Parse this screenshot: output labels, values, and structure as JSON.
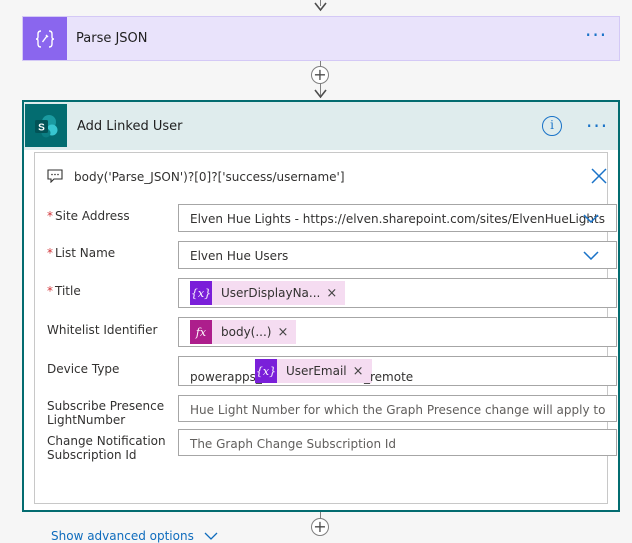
{
  "parse_json": {
    "title": "Parse JSON",
    "more_label": "···",
    "icon": "braces-icon",
    "accent": "#8a66ee"
  },
  "action": {
    "title": "Add Linked User",
    "info_label": "i",
    "more_label": "···",
    "icon": "sharepoint-icon",
    "accent": "#036c70",
    "foreach_expression": "body('Parse_JSON')?[0]?['success/username']",
    "fields": {
      "site_address": {
        "label": "Site Address",
        "required_mark": "*",
        "value": "Elven Hue Lights - https://elven.sharepoint.com/sites/ElvenHueLights"
      },
      "list_name": {
        "label": "List Name",
        "required_mark": "*",
        "value": "Elven Hue Users"
      },
      "title": {
        "label": "Title",
        "required_mark": "*",
        "token": {
          "label": "UserDisplayNa...",
          "icon_text": "{x}"
        },
        "remove": "×"
      },
      "whitelist_identifier": {
        "label": "Whitelist Identifier",
        "token": {
          "label": "body(...)",
          "icon_text": "fx"
        },
        "remove": "×"
      },
      "device_type": {
        "label": "Device Type",
        "prefix": "powerapps_",
        "token": {
          "label": "UserEmail",
          "icon_text": "{x}"
        },
        "remove": "×",
        "suffix": "_remote"
      },
      "subscribe_presence": {
        "label_line1": "Subscribe Presence",
        "label_line2": "LightNumber",
        "placeholder": "Hue Light Number for which the Graph Presence change will apply to"
      },
      "change_notification": {
        "label_line1": "Change Notification",
        "label_line2": "Subscription Id",
        "placeholder": "The Graph Change Subscription Id"
      }
    },
    "show_advanced": "Show advanced options"
  },
  "connector_plus": "+"
}
